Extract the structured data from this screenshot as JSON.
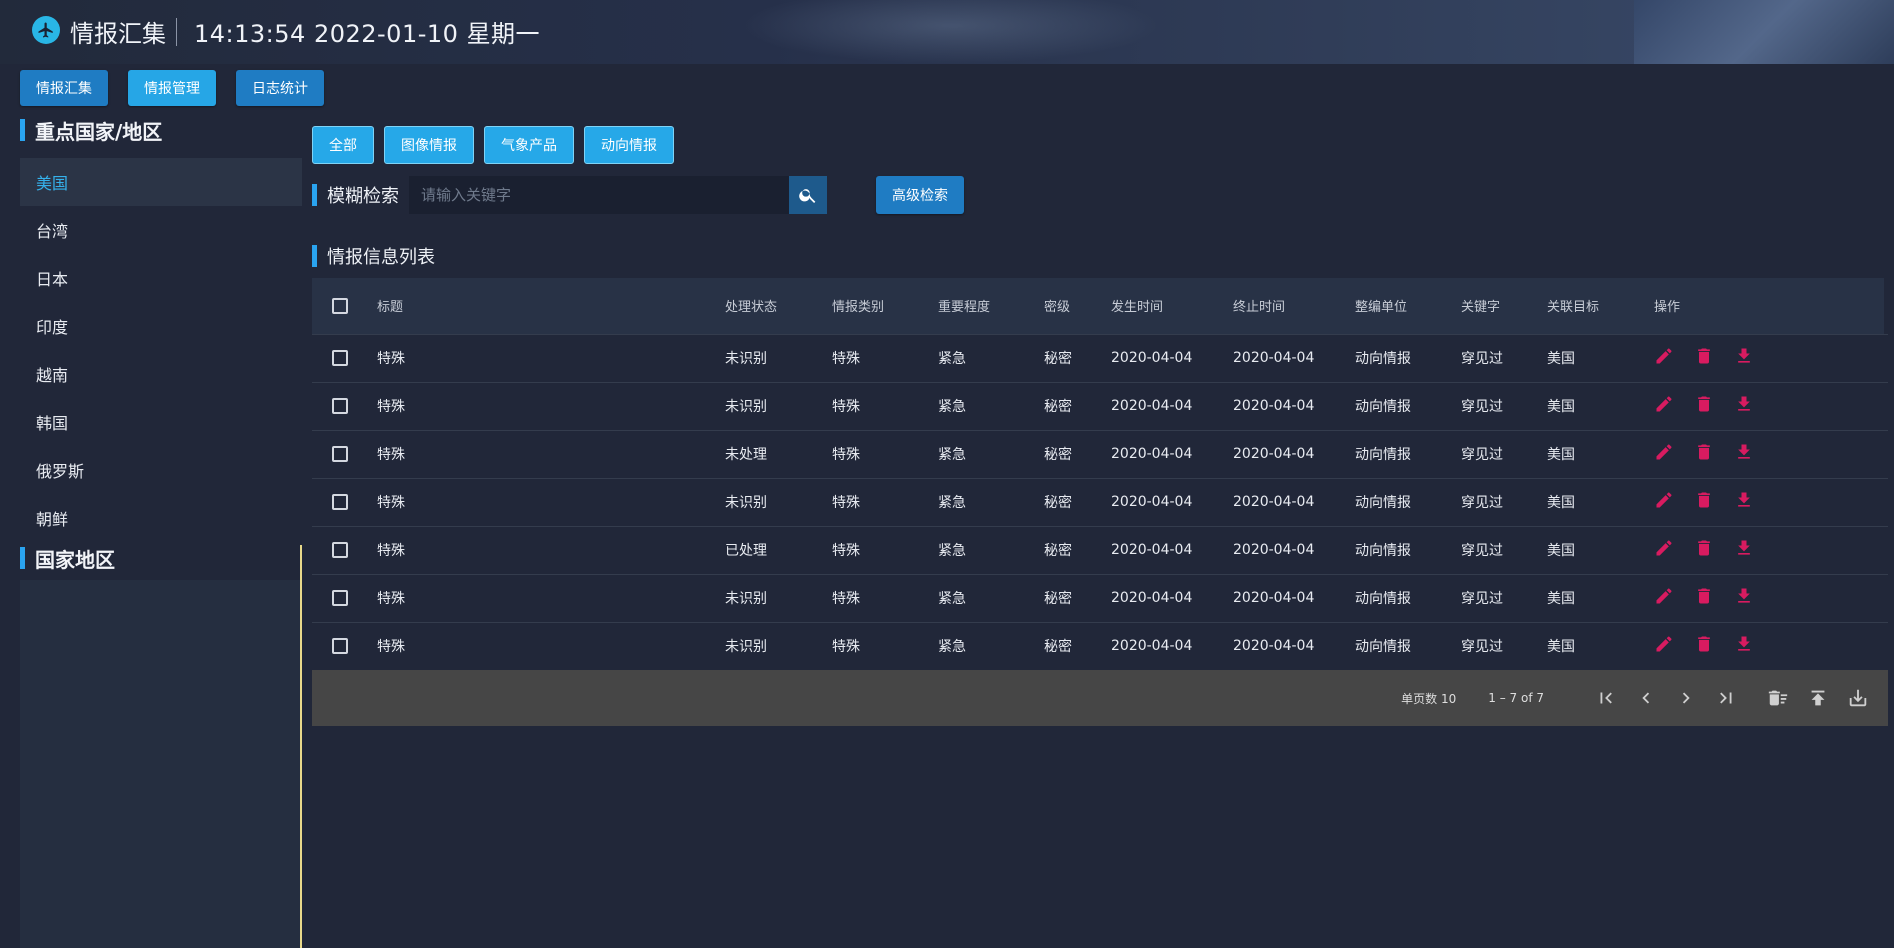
{
  "header": {
    "title": "情报汇集",
    "time": "14:13:54",
    "date": "2022-01-10",
    "weekday": "星期一"
  },
  "topnav": [
    "情报汇集",
    "情报管理",
    "日志统计"
  ],
  "sidebar": {
    "section1_title": "重点国家/地区",
    "items": [
      "美国",
      "台湾",
      "日本",
      "印度",
      "越南",
      "韩国",
      "俄罗斯",
      "朝鲜"
    ],
    "section2_title": "国家地区"
  },
  "filters": [
    "全部",
    "图像情报",
    "气象产品",
    "动向情报"
  ],
  "search": {
    "label": "模糊检索",
    "placeholder": "请输入关键字",
    "advanced_label": "高级检索"
  },
  "list_title": "情报信息列表",
  "table": {
    "columns": [
      "标题",
      "处理状态",
      "情报类别",
      "重要程度",
      "密级",
      "发生时间",
      "终止时间",
      "整编单位",
      "关键字",
      "关联目标",
      "操作"
    ],
    "rows": [
      [
        "特殊",
        "未识别",
        "特殊",
        "紧急",
        "秘密",
        "2020-04-04",
        "2020-04-04",
        "动向情报",
        "穿见过",
        "美国"
      ],
      [
        "特殊",
        "未识别",
        "特殊",
        "紧急",
        "秘密",
        "2020-04-04",
        "2020-04-04",
        "动向情报",
        "穿见过",
        "美国"
      ],
      [
        "特殊",
        "未处理",
        "特殊",
        "紧急",
        "秘密",
        "2020-04-04",
        "2020-04-04",
        "动向情报",
        "穿见过",
        "美国"
      ],
      [
        "特殊",
        "未识别",
        "特殊",
        "紧急",
        "秘密",
        "2020-04-04",
        "2020-04-04",
        "动向情报",
        "穿见过",
        "美国"
      ],
      [
        "特殊",
        "已处理",
        "特殊",
        "紧急",
        "秘密",
        "2020-04-04",
        "2020-04-04",
        "动向情报",
        "穿见过",
        "美国"
      ],
      [
        "特殊",
        "未识别",
        "特殊",
        "紧急",
        "秘密",
        "2020-04-04",
        "2020-04-04",
        "动向情报",
        "穿见过",
        "美国"
      ],
      [
        "特殊",
        "未识别",
        "特殊",
        "紧急",
        "秘密",
        "2020-04-04",
        "2020-04-04",
        "动向情报",
        "穿见过",
        "美国"
      ]
    ]
  },
  "pagination": {
    "rows_per_page_label": "单页数 10",
    "range_label": "1 – 7 of 7"
  },
  "colors": {
    "background": "#212739",
    "accent": "#26a6e6",
    "action_icon": "#d81b60",
    "footer_bg": "#464646"
  },
  "icons": {
    "logo": "airplane-icon",
    "search": "search-icon",
    "row_actions": [
      "edit-icon",
      "delete-icon",
      "download-icon"
    ],
    "pager": [
      "first-page-icon",
      "prev-page-icon",
      "next-page-icon",
      "last-page-icon",
      "clear-all-icon",
      "upload-icon",
      "export-icon"
    ]
  }
}
